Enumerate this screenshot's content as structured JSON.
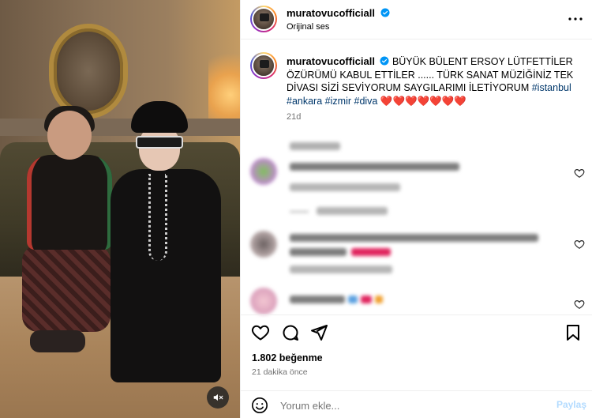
{
  "post": {
    "username": "muratovucofficiall",
    "audio": "Orijinal ses",
    "caption": {
      "text": "BÜYÜK BÜLENT ERSOY LÜTFETTİLER ÖZÜRÜMÜ KABUL ETTİLER ...... TÜRK SANAT MÜZİĞİNİZ TEK DİVASI SİZİ SEVİYORUM SAYGILARIMI İLETİYORUM ",
      "hashtags": [
        "#istanbul",
        "#ankara",
        "#izmir",
        "#diva"
      ],
      "emojis": "❤️❤️❤️❤️❤️❤️❤️",
      "age": "21d"
    },
    "likes": "1.802 beğenme",
    "posted_ago": "21 dakika önce"
  },
  "comment_form": {
    "placeholder": "Yorum ekle...",
    "post_label": "Paylaş"
  },
  "icons": {
    "verified": "verified-badge-icon",
    "more": "more-options-icon",
    "like": "heart-icon",
    "comment": "comment-bubble-icon",
    "share": "paper-plane-icon",
    "save": "bookmark-icon",
    "emoji": "smiley-icon",
    "mute": "muted-speaker-icon"
  },
  "colors": {
    "verified_blue": "#0095f6",
    "hashtag": "#00376b",
    "secondary_text": "#737373",
    "post_button_disabled": "#b3dbff",
    "heart_emoji": "#e0245e"
  }
}
